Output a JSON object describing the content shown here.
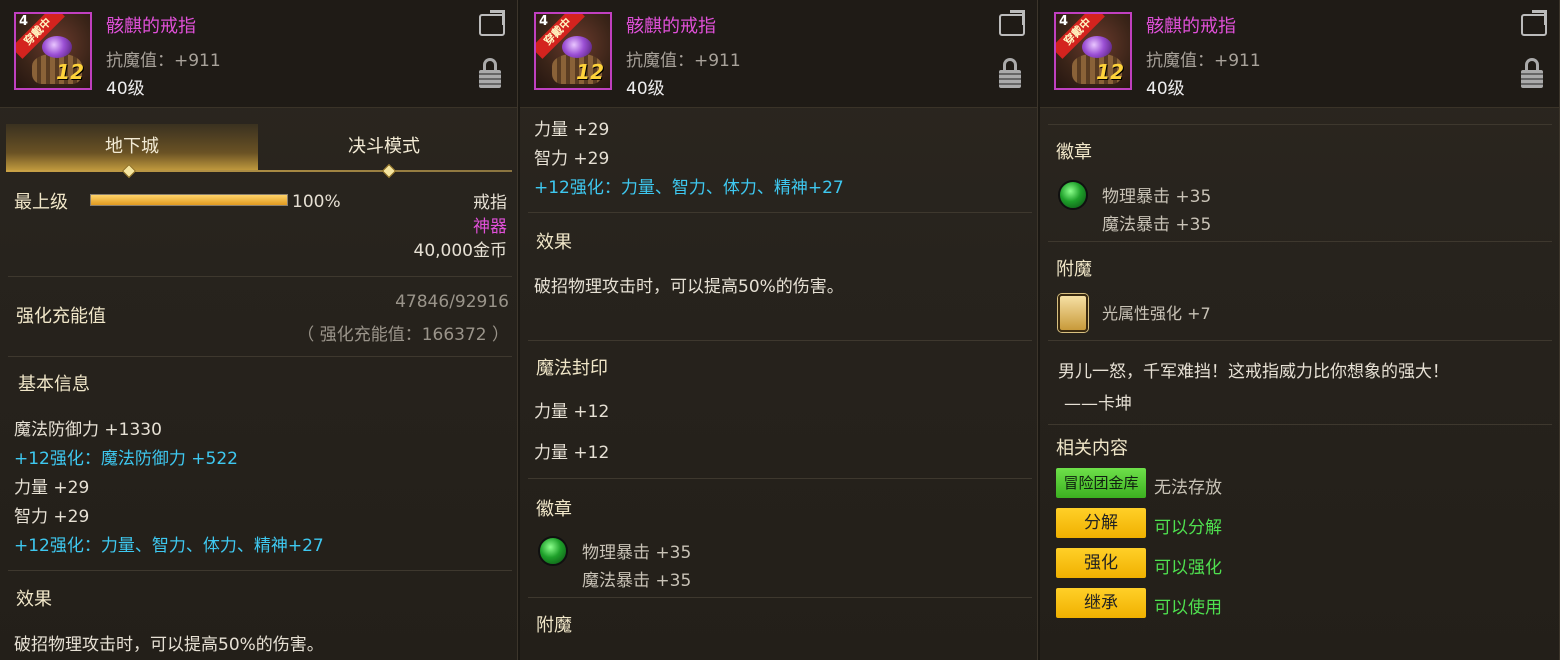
{
  "item": {
    "name": "骸麒的戒指",
    "resist": "抗魔值：+911",
    "level": "40级",
    "badge": "穿戴中",
    "corner_level": "4",
    "plus": "12",
    "colors": {
      "name": "#e050d8",
      "rarity": "#e050d8",
      "accent": "#ffd23a"
    }
  },
  "panel1": {
    "tabs": [
      "地下城",
      "决斗模式"
    ],
    "grade_label": "最上级",
    "grade_percent": "100%",
    "grade_fill": 1.0,
    "slot": "戒指",
    "rarity": "神器",
    "price": "40,000金币",
    "charge_label": "强化充能值",
    "charge_value": "47846/92916",
    "charge_total": "（ 强化充能值：166372 ）",
    "basic_title": "基本信息",
    "stats": [
      {
        "text": "魔法防御力 +1330"
      },
      {
        "text": "+12强化：魔法防御力 +522"
      },
      {
        "text": "力量 +29"
      },
      {
        "text": "智力 +29"
      },
      {
        "text": "+12强化：力量、智力、体力、精神+27"
      }
    ],
    "effect_title": "效果",
    "effect_text": "破招物理攻击时，可以提高50%的伤害。"
  },
  "panel2": {
    "stats": [
      "力量 +29",
      "智力 +29",
      "+12强化：力量、智力、体力、精神+27"
    ],
    "effect_title": "效果",
    "effect_text": "破招物理攻击时，可以提高50%的伤害。",
    "seal_title": "魔法封印",
    "seal_lines": [
      "力量 +12",
      "力量 +12"
    ],
    "emblem_title": "徽章",
    "emblem_lines": [
      "物理暴击 +35",
      "魔法暴击 +35"
    ],
    "enchant_title": "附魔"
  },
  "panel3": {
    "emblem_title": "徽章",
    "emblem_lines": [
      "物理暴击 +35",
      "魔法暴击 +35"
    ],
    "enchant_title": "附魔",
    "enchant_text": "光属性强化 +7",
    "flavor_line1": "男儿一怒，千军难挡！这戒指威力比你想象的强大！",
    "flavor_line2": "——卡坤",
    "related_title": "相关内容",
    "related": [
      {
        "button": "冒险团金库",
        "text": "无法存放"
      },
      {
        "button": "分解",
        "text": "可以分解"
      },
      {
        "button": "强化",
        "text": "可以强化"
      },
      {
        "button": "继承",
        "text": "可以使用"
      }
    ]
  }
}
